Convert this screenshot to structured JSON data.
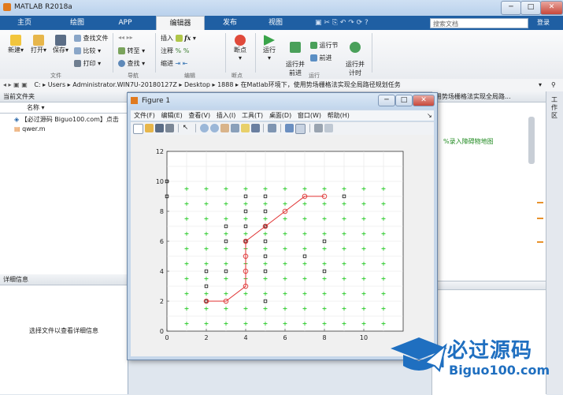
{
  "app": {
    "title": "MATLAB R2018a",
    "window_buttons": [
      "─",
      "□",
      "✕"
    ]
  },
  "tabs": [
    {
      "label": "主页",
      "active": false
    },
    {
      "label": "绘图",
      "active": false
    },
    {
      "label": "APP",
      "active": false
    },
    {
      "label": "编辑器",
      "active": true
    },
    {
      "label": "发布",
      "active": false
    },
    {
      "label": "视图",
      "active": false
    }
  ],
  "search": {
    "placeholder": "搜索文档"
  },
  "login_label": "登录",
  "ribbon": {
    "file": {
      "new": "新建",
      "open": "打开",
      "save": "保存",
      "find_files": "查找文件",
      "compare": "比较",
      "print": "打印",
      "group": "文件"
    },
    "navigate": {
      "goto": "转至",
      "find": "查找",
      "group": "导航"
    },
    "edit": {
      "insert": "插入",
      "comment": "注释",
      "indent": "缩进",
      "fx": "fx",
      "group": "编辑"
    },
    "breakpoints": {
      "label": "断点",
      "group": "断点"
    },
    "run": {
      "run": "运行",
      "run_advance": "运行并\n前进",
      "run_section": "运行节",
      "advance": "前进",
      "run_time": "运行并\n计时",
      "group": "运行"
    }
  },
  "address": {
    "path": [
      "C:",
      "Users",
      "Administrator.WIN7U-20180127Z",
      "Desktop",
      "1888",
      "在Matlab环境下，使用势场栅格法实现全局路径规划任务"
    ]
  },
  "left_panel": {
    "title": "当前文件夹",
    "col_name": "名称",
    "files": [
      "【必过源码 Biguo100.com】点击",
      "qwer.m"
    ],
    "details_title": "详细信息",
    "details_hint": "选择文件以查看详细信息"
  },
  "editor": {
    "tab_title": "用势场栅格法实现全局路...",
    "code_comment": "%录入障碍物地图"
  },
  "workspace_label": "工作区",
  "figure": {
    "title": "Figure 1",
    "menu": [
      "文件(F)",
      "编辑(E)",
      "查看(V)",
      "插入(I)",
      "工具(T)",
      "桌面(D)",
      "窗口(W)",
      "帮助(H)"
    ]
  },
  "chart_data": {
    "type": "scatter",
    "title": "",
    "xlabel": "",
    "ylabel": "",
    "xlim": [
      0,
      12
    ],
    "ylim": [
      0,
      12
    ],
    "xticks": [
      0,
      2,
      4,
      6,
      8,
      10
    ],
    "yticks": [
      0,
      2,
      4,
      6,
      8,
      10,
      12
    ],
    "grid": true,
    "series": [
      {
        "marker": "+",
        "color": "#33cc33",
        "note_grid": true,
        "xs": [
          1,
          2,
          3,
          4,
          5,
          6,
          7,
          8,
          9,
          10,
          11
        ],
        "ys": [
          0.5,
          1.5,
          2.5,
          3.5,
          4.5,
          5.5,
          6.5,
          7.5,
          8.5,
          9.5
        ]
      },
      {
        "marker": "square",
        "color": "#111111",
        "points": [
          [
            0,
            10
          ],
          [
            0,
            9
          ],
          [
            4,
            9
          ],
          [
            5,
            9
          ],
          [
            9,
            9
          ],
          [
            4,
            8
          ],
          [
            5,
            8
          ],
          [
            3,
            7
          ],
          [
            4,
            7
          ],
          [
            5,
            7
          ],
          [
            3,
            6
          ],
          [
            4,
            6
          ],
          [
            5,
            6
          ],
          [
            8,
            6
          ],
          [
            5,
            5
          ],
          [
            7,
            5
          ],
          [
            5,
            4
          ],
          [
            2,
            4
          ],
          [
            3,
            4
          ],
          [
            8,
            4
          ],
          [
            2,
            3
          ],
          [
            2,
            2
          ],
          [
            5,
            2
          ]
        ]
      },
      {
        "marker": "circle-line",
        "color": "#e03030",
        "points": [
          [
            2,
            2
          ],
          [
            3,
            2
          ],
          [
            4,
            3
          ],
          [
            4,
            4
          ],
          [
            4,
            5
          ],
          [
            4,
            6
          ],
          [
            5,
            7
          ],
          [
            6,
            8
          ],
          [
            7,
            9
          ],
          [
            8,
            9
          ]
        ]
      }
    ]
  },
  "watermark": {
    "brand": "必过源码",
    "url": "Biguo100.com"
  },
  "colors": {
    "accent": "#1f5fa3",
    "grid_plus": "#33cc33",
    "path": "#e03030"
  }
}
